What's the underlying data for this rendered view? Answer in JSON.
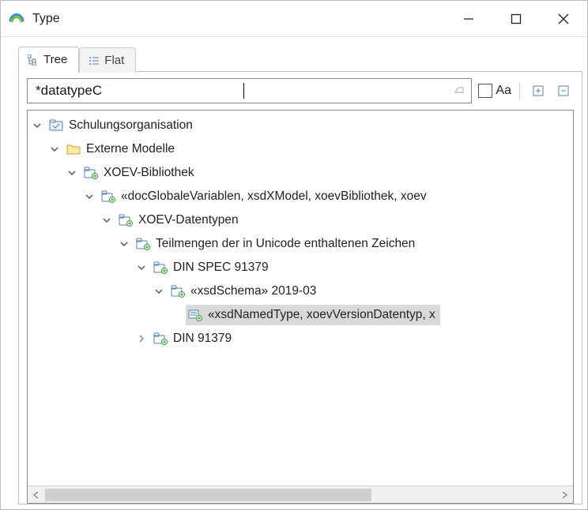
{
  "window": {
    "title": "Type"
  },
  "tabs": {
    "tree": "Tree",
    "flat": "Flat",
    "active": "tree"
  },
  "search": {
    "value": "*datatypeC",
    "match_case_label": "Aa"
  },
  "tree": {
    "items": [
      {
        "label": "Schulungsorganisation",
        "depth": 0,
        "expanded": true,
        "icon": "model",
        "selected": false
      },
      {
        "label": "Externe Modelle",
        "depth": 1,
        "expanded": true,
        "icon": "folder",
        "selected": false
      },
      {
        "label": "XOEV-Bibliothek",
        "depth": 2,
        "expanded": true,
        "icon": "package-plus",
        "selected": false
      },
      {
        "label": "«docGlobaleVariablen, xsdXModel, xoevBibliothek, xoev",
        "depth": 3,
        "expanded": true,
        "icon": "package-plus",
        "selected": false
      },
      {
        "label": "XOEV-Datentypen",
        "depth": 4,
        "expanded": true,
        "icon": "package-plus",
        "selected": false
      },
      {
        "label": "Teilmengen der in Unicode enthaltenen Zeichen",
        "depth": 5,
        "expanded": true,
        "icon": "package-plus",
        "selected": false
      },
      {
        "label": "DIN SPEC 91379",
        "depth": 6,
        "expanded": true,
        "icon": "package-plus",
        "selected": false
      },
      {
        "label": "«xsdSchema» 2019-03",
        "depth": 7,
        "expanded": true,
        "icon": "package-plus",
        "selected": false
      },
      {
        "label": "«xsdNamedType, xoevVersionDatentyp, x",
        "depth": 8,
        "expanded": null,
        "icon": "element-plus",
        "selected": true
      },
      {
        "label": "DIN 91379",
        "depth": 6,
        "expanded": false,
        "icon": "package-plus",
        "selected": false
      }
    ]
  }
}
